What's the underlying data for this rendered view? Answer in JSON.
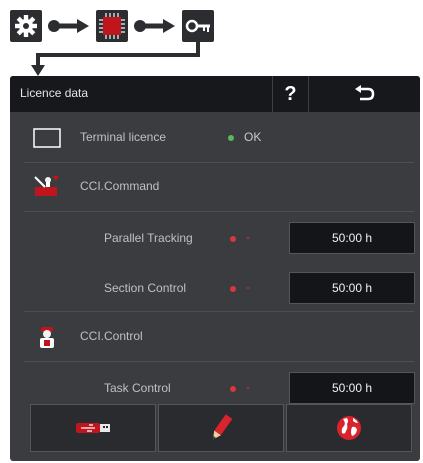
{
  "title_bar": {
    "title": "Licence data",
    "help_label": "?"
  },
  "licences": {
    "terminal": {
      "label": "Terminal licence",
      "status": "OK",
      "status_color": "#5cb85c"
    },
    "cci_command": {
      "label": "CCI.Command",
      "items": [
        {
          "label": "Parallel Tracking",
          "status": "-",
          "value": "50:00 h",
          "status_color": "#d9363e"
        },
        {
          "label": "Section Control",
          "status": "-",
          "value": "50:00 h",
          "status_color": "#d9363e"
        }
      ]
    },
    "cci_control": {
      "label": "CCI.Control",
      "items": [
        {
          "label": "Task Control",
          "status": "-",
          "value": "50:00 h",
          "status_color": "#d9363e"
        }
      ]
    }
  },
  "bottom_bar": [
    "usb-icon",
    "pencil-icon",
    "globe-icon"
  ],
  "colors": {
    "accent_red": "#c0151c",
    "panel": "#3b3c40",
    "titlebar": "#17181b"
  }
}
